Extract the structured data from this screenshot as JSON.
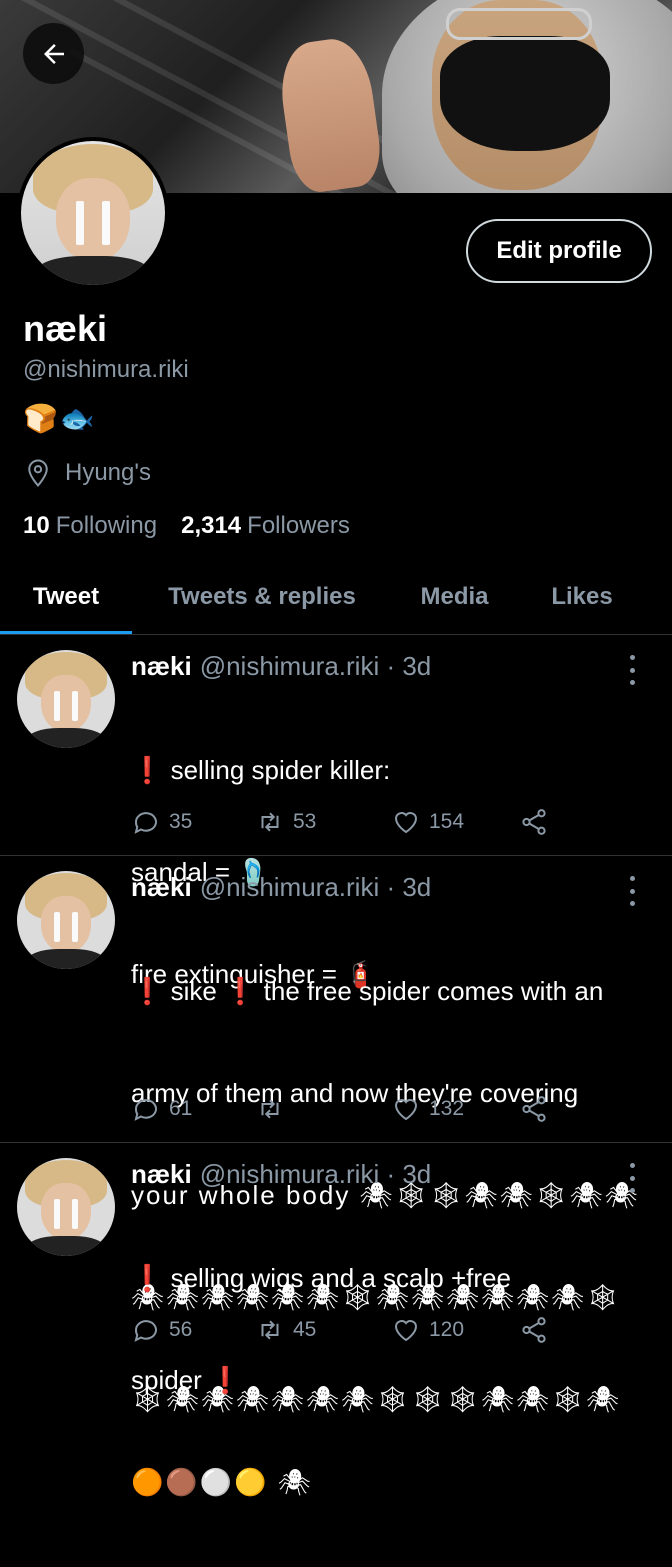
{
  "header": {
    "back_icon": "arrow-left-icon"
  },
  "profile": {
    "edit_label": "Edit profile",
    "name": "næki",
    "handle": "@nishimura.riki",
    "bio_emojis": [
      "🍞",
      "🐟"
    ],
    "location": "Hyung's",
    "following_count": "10",
    "following_label": "Following",
    "followers_count": "2,314",
    "followers_label": "Followers"
  },
  "tabs": [
    "Tweet",
    "Tweets & replies",
    "Media",
    "Likes"
  ],
  "active_tab": "Tweet",
  "accent_color": "#1d9bf0",
  "tweets": [
    {
      "name": "næki",
      "handle": "@nishimura.riki",
      "date": "· 3d",
      "line1": "❗ selling spider killer:",
      "line2": "sandal = 🩴",
      "line3": "fire extinguisher = 🧯",
      "replies": "35",
      "retweets": "53",
      "likes": "154"
    },
    {
      "name": "næki",
      "handle": "@nishimura.riki",
      "date": "· 3d",
      "line1": "❗ sike ❗ the free spider comes with an",
      "line2": "army of them and now they're covering",
      "line3": "your whole body 🕷🕸🕸🕷🕷🕸🕷🕷",
      "line4": "🕷🕷🕷🕷🕷🕷🕸🕷🕷🕷🕷🕷🕷🕸",
      "line5": "🕸🕷🕷🕷🕷🕷🕷🕸🕸🕸🕷🕷🕸🕷",
      "replies": "61",
      "retweets": "",
      "likes": "132"
    },
    {
      "name": "næki",
      "handle": "@nishimura.riki",
      "date": "· 3d",
      "line1": "❗ selling wigs and a scalp +free",
      "line2": "spider ❗",
      "line3": "🟠🟤⚪🟡 🕷",
      "replies": "56",
      "retweets": "45",
      "likes": "120"
    }
  ]
}
